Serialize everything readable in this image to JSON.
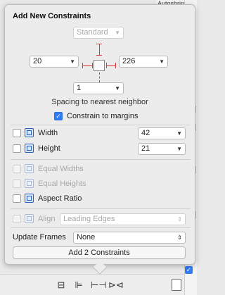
{
  "background": {
    "top_label": "Autoshrink",
    "right_chips": [
      "",
      ""
    ],
    "bottom_icons": [
      "stack-icon",
      "align-icon",
      "pin-icon",
      "resolve-icon"
    ]
  },
  "popover": {
    "title": "Add New Constraints",
    "top_spacing": {
      "value": "Standard",
      "placeholder": true
    },
    "left_spacing": "20",
    "right_spacing": "226",
    "bottom_spacing": "1",
    "spacing_caption": "Spacing to nearest neighbor",
    "constrain_to_margins": {
      "label": "Constrain to margins",
      "checked": true
    },
    "width": {
      "label": "Width",
      "value": "42",
      "checked": false
    },
    "height": {
      "label": "Height",
      "value": "21",
      "checked": false
    },
    "equal_widths": {
      "label": "Equal Widths",
      "checked": false,
      "enabled": false
    },
    "equal_heights": {
      "label": "Equal Heights",
      "checked": false,
      "enabled": false
    },
    "aspect_ratio": {
      "label": "Aspect Ratio",
      "checked": false,
      "enabled": true
    },
    "align": {
      "label": "Align",
      "value": "Leading Edges",
      "enabled": false
    },
    "update_frames": {
      "label": "Update Frames",
      "value": "None"
    },
    "add_button": "Add 2 Constraints"
  },
  "colors": {
    "accent": "#2f7cf6",
    "strut": "#dd3333"
  }
}
